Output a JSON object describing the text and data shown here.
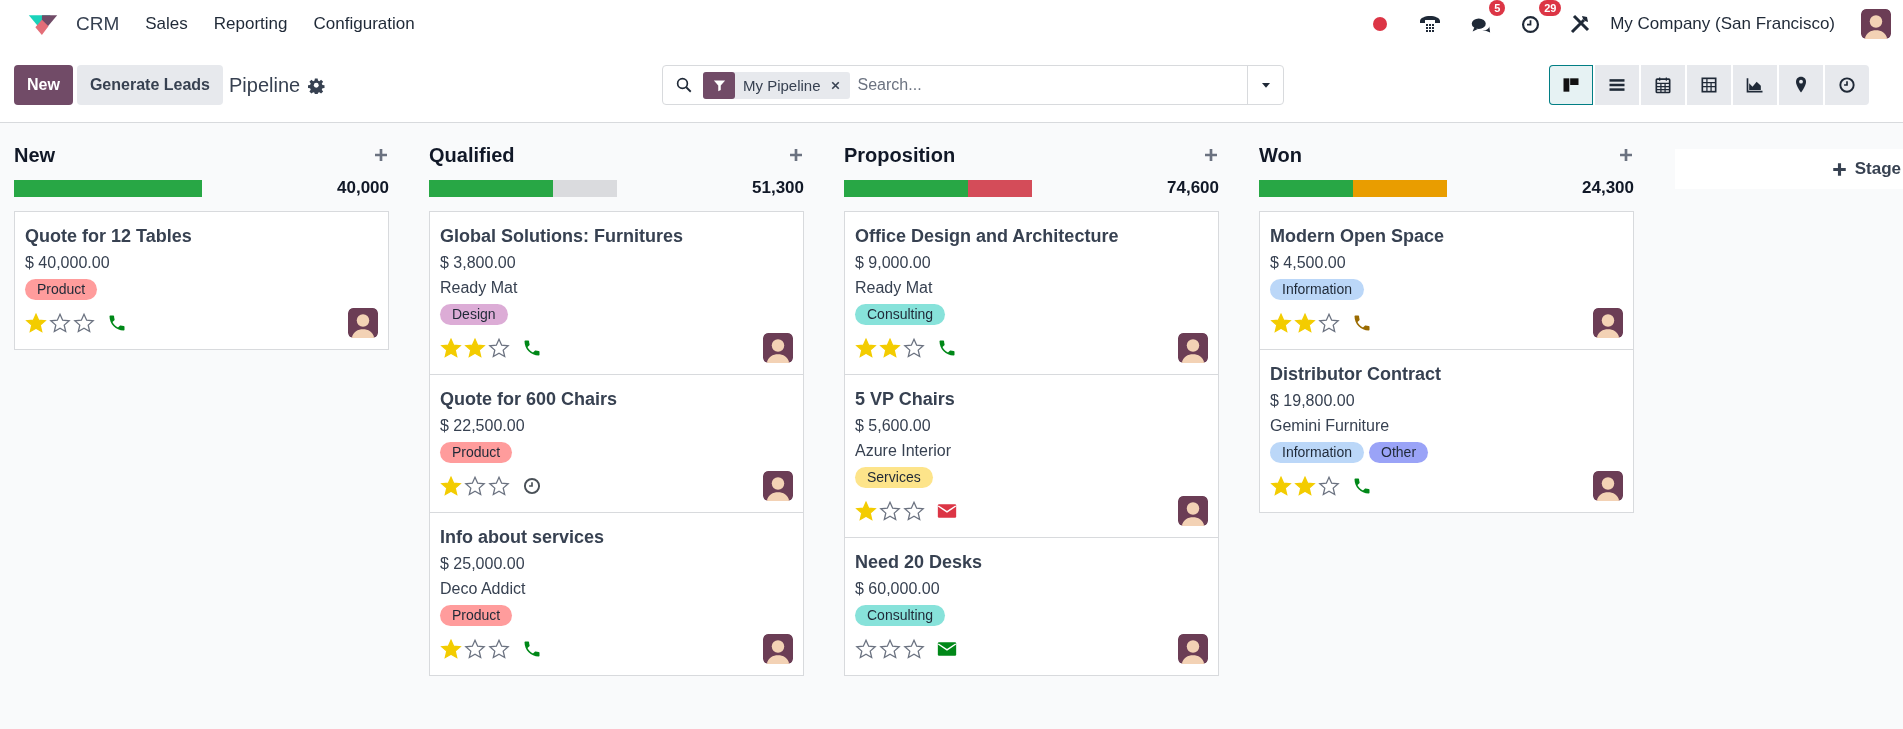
{
  "navbar": {
    "app_name": "CRM",
    "menu": [
      "Sales",
      "Reporting",
      "Configuration"
    ],
    "messages_badge": "5",
    "activities_badge": "29",
    "company": "My Company (San Francisco)"
  },
  "control_panel": {
    "buttons": [
      {
        "label": "New",
        "kind": "primary"
      },
      {
        "label": "Generate Leads",
        "kind": "secondary"
      }
    ],
    "breadcrumb": "Pipeline",
    "search": {
      "facets": [
        {
          "label": "My Pipeline"
        }
      ],
      "placeholder": "Search..."
    },
    "views": [
      {
        "kind": "kanban",
        "selected": true
      },
      {
        "kind": "list",
        "selected": false
      },
      {
        "kind": "calendar",
        "selected": false
      },
      {
        "kind": "pivot",
        "selected": false
      },
      {
        "kind": "graph",
        "selected": false
      },
      {
        "kind": "map",
        "selected": false
      },
      {
        "kind": "activity",
        "selected": false
      }
    ]
  },
  "columns": [
    {
      "title": "New",
      "total": "40,000",
      "progress": [
        {
          "level": 1,
          "color": "#28a745"
        }
      ],
      "cards": [
        {
          "title": "Quote for 12 Tables",
          "amount": "$ 40,000.00",
          "tags": [
            {
              "label": "Product",
              "color": "#ff9c9c"
            }
          ],
          "stars": 1,
          "activity": {
            "kind": "phone",
            "color": "#008818"
          }
        }
      ]
    },
    {
      "title": "Qualified",
      "total": "51,300",
      "progress": [
        {
          "level": 0.66,
          "color": "#28a745"
        },
        {
          "level": 0.34,
          "color": "#dadbde"
        }
      ],
      "cards": [
        {
          "title": "Global Solutions: Furnitures",
          "amount": "$ 3,800.00",
          "customer": "Ready Mat",
          "tags": [
            {
              "label": "Design",
              "color": "#dcacd6"
            }
          ],
          "stars": 2,
          "activity": {
            "kind": "phone",
            "color": "#008818"
          }
        },
        {
          "title": "Quote for 600 Chairs",
          "amount": "$ 22,500.00",
          "tags": [
            {
              "label": "Product",
              "color": "#ff9c9c"
            }
          ],
          "stars": 1,
          "activity": {
            "kind": "clock",
            "color": "#495057"
          }
        },
        {
          "title": "Info about services",
          "amount": "$ 25,000.00",
          "customer": "Deco Addict",
          "tags": [
            {
              "label": "Product",
              "color": "#ff9c9c"
            }
          ],
          "stars": 1,
          "activity": {
            "kind": "phone",
            "color": "#008818"
          }
        }
      ]
    },
    {
      "title": "Proposition",
      "total": "74,600",
      "progress": [
        {
          "level": 0.66,
          "color": "#28a745"
        },
        {
          "level": 0.34,
          "color": "#d44c59"
        }
      ],
      "cards": [
        {
          "title": "Office Design and Architecture",
          "amount": "$ 9,000.00",
          "customer": "Ready Mat",
          "tags": [
            {
              "label": "Consulting",
              "color": "#87e2da"
            }
          ],
          "stars": 2,
          "activity": {
            "kind": "phone",
            "color": "#008818"
          }
        },
        {
          "title": "5 VP Chairs",
          "amount": "$ 5,600.00",
          "customer": "Azure Interior",
          "tags": [
            {
              "label": "Services",
              "color": "#fde48a"
            }
          ],
          "stars": 1,
          "activity": {
            "kind": "email",
            "color": "#dc3545"
          }
        },
        {
          "title": "Need 20 Desks",
          "amount": "$ 60,000.00",
          "tags": [
            {
              "label": "Consulting",
              "color": "#87e2da"
            }
          ],
          "stars": 0,
          "activity": {
            "kind": "email",
            "color": "#008818"
          }
        }
      ]
    },
    {
      "title": "Won",
      "total": "24,300",
      "progress": [
        {
          "level": 0.5,
          "color": "#28a745"
        },
        {
          "level": 0.5,
          "color": "#e99d00"
        }
      ],
      "cards": [
        {
          "title": "Modern Open Space",
          "amount": "$ 4,500.00",
          "tags": [
            {
              "label": "Information",
              "color": "#bbd7f8"
            }
          ],
          "stars": 2,
          "activity": {
            "kind": "phone",
            "color": "#9a6b01"
          }
        },
        {
          "title": "Distributor Contract",
          "amount": "$ 19,800.00",
          "customer": "Gemini Furniture",
          "tags": [
            {
              "label": "Information",
              "color": "#bbd7f8"
            },
            {
              "label": "Other",
              "color": "#9aa3f7"
            }
          ],
          "stars": 2,
          "activity": {
            "kind": "phone",
            "color": "#008818"
          }
        }
      ]
    }
  ],
  "add_stage": {
    "label": "Stage"
  }
}
